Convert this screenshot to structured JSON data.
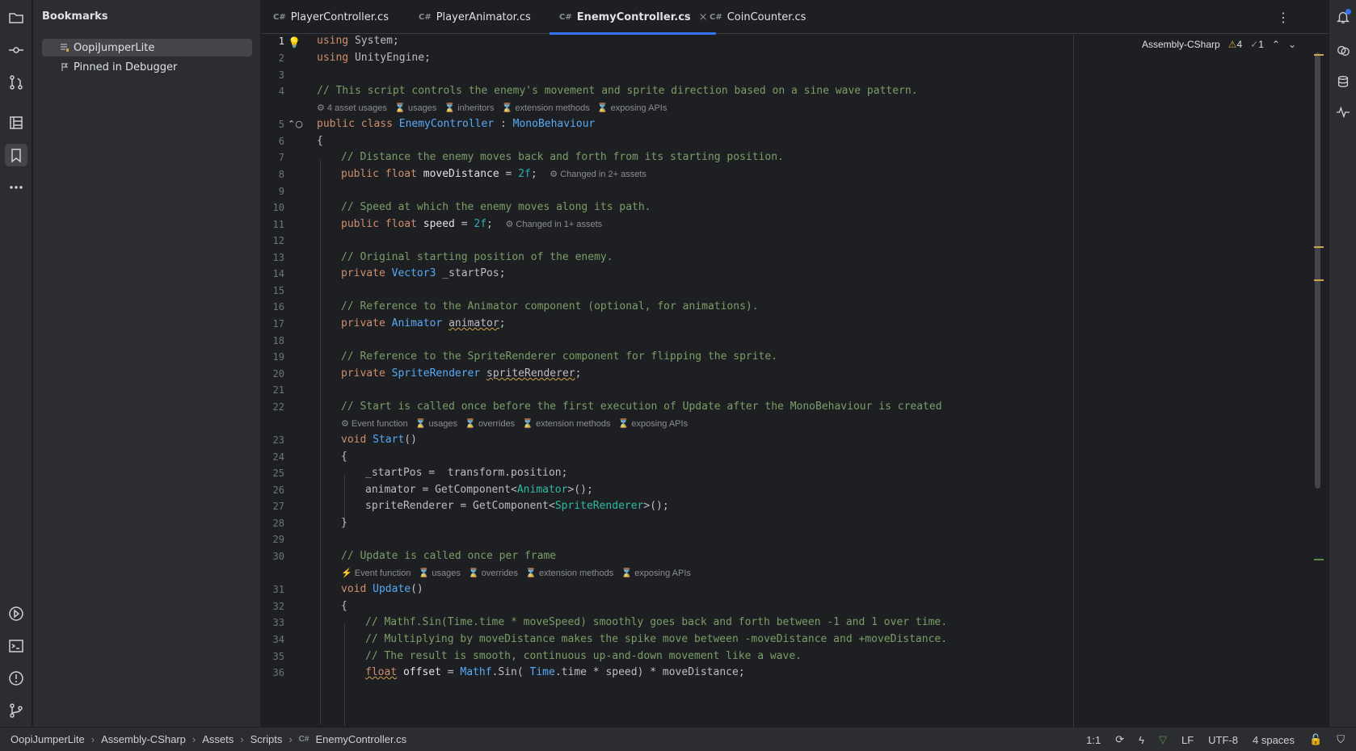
{
  "bookmarks": {
    "title": "Bookmarks",
    "items": [
      {
        "label": "OopiJumperLite"
      },
      {
        "label": "Pinned in Debugger"
      }
    ]
  },
  "tabs": [
    {
      "icon": "C#",
      "label": "PlayerController.cs"
    },
    {
      "icon": "C#",
      "label": "PlayerAnimator.cs"
    },
    {
      "icon": "C#",
      "label": "EnemyController.cs",
      "close": "×"
    },
    {
      "icon": "C#",
      "label": "CoinCounter.cs"
    }
  ],
  "editor": {
    "context": "Assembly-CSharp",
    "warnings": "4",
    "ok": "1",
    "line_numbers": [
      "1",
      "2",
      "3",
      "4",
      "5",
      "6",
      "7",
      "8",
      "9",
      "10",
      "11",
      "12",
      "13",
      "14",
      "15",
      "16",
      "17",
      "18",
      "19",
      "20",
      "21",
      "22",
      "23",
      "24",
      "25",
      "26",
      "27",
      "28",
      "29",
      "30",
      "31",
      "32",
      "33",
      "34",
      "35",
      "36"
    ],
    "hint_class": "⚙ 4 asset usages   ⌛ usages   ⌛ inheritors   ⌛ extension methods   ⌛ exposing APIs",
    "hint_start": "⚙ Event function   ⌛ usages   ⌛ overrides   ⌛ extension methods   ⌛ exposing APIs",
    "hint_update": "⚡ Event function   ⌛ usages   ⌛ overrides   ⌛ extension methods   ⌛ exposing APIs",
    "inlay_changed2": "⚙ Changed in 2+ assets",
    "inlay_changed1": "⚙ Changed in 1+ assets",
    "code": {
      "l1": "using System;",
      "l2": "using UnityEngine;",
      "l4": "// This script controls the enemy's movement and sprite direction based on a sine wave pattern.",
      "l7": "// Distance the enemy moves back and forth from its starting position.",
      "l10": "// Speed at which the enemy moves along its path.",
      "l13": "// Original starting position of the enemy.",
      "l16": "// Reference to the Animator component (optional, for animations).",
      "l19": "// Reference to the SpriteRenderer component for flipping the sprite.",
      "l22": "// Start is called once before the first execution of Update after the MonoBehaviour is created",
      "l30": "// Update is called once per frame",
      "l33": "// Mathf.Sin(Time.time * moveSpeed) smoothly goes back and forth between -1 and 1 over time.",
      "l34": "// Multiplying by moveDistance makes the spike move between -moveDistance and +moveDistance.",
      "l35": "// The result is smooth, continuous up-and-down movement like a wave."
    }
  },
  "statusbar": {
    "crumbs": [
      "OopiJumperLite",
      "Assembly-CSharp",
      "Assets",
      "Scripts",
      "EnemyController.cs"
    ],
    "crumb_icon": "C#",
    "position": "1:1",
    "line_ending": "LF",
    "encoding": "UTF-8",
    "indent": "4 spaces"
  },
  "colors": {
    "accent": "#3574f0",
    "keyword": "#cf8e6d",
    "comment": "#7a9e67",
    "type": "#57aaf7"
  }
}
